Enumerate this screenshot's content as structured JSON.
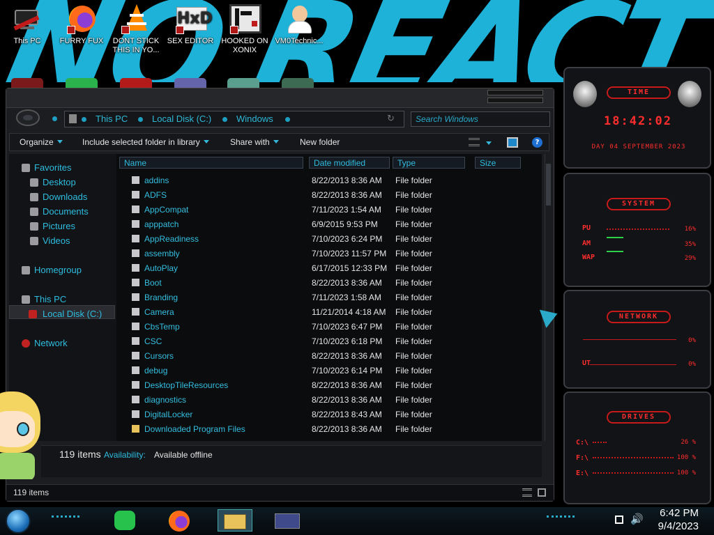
{
  "desktop": {
    "wallpaper_text": "NO REACT",
    "icons": [
      {
        "label": "This PC",
        "icon": "computer-icon"
      },
      {
        "label": "FURRY FUX",
        "icon": "firefox-icon"
      },
      {
        "label": "DONT STICK THIS IN YO...",
        "icon": "vlc-icon"
      },
      {
        "label": "SEX EDITOR",
        "icon": "hxd-icon"
      },
      {
        "label": "HOOKED ON XONIX",
        "icon": "xonix-icon"
      },
      {
        "label": "VM0Technic...",
        "icon": "user-icon"
      }
    ]
  },
  "explorer": {
    "breadcrumb": [
      "This PC",
      "Local Disk (C:)",
      "Windows"
    ],
    "search_placeholder": "Search Windows",
    "toolbar": {
      "organize": "Organize",
      "include": "Include selected folder in library",
      "share": "Share with",
      "new_folder": "New folder"
    },
    "nav": {
      "favorites": "Favorites",
      "desktop": "Desktop",
      "downloads": "Downloads",
      "documents": "Documents",
      "pictures": "Pictures",
      "videos": "Videos",
      "homegroup": "Homegroup",
      "this_pc": "This PC",
      "local_disk": "Local Disk (C:)",
      "network": "Network"
    },
    "columns": {
      "name": "Name",
      "date": "Date modified",
      "type": "Type",
      "size": "Size"
    },
    "rows": [
      {
        "name": "addins",
        "date": "8/22/2013 8:36 AM",
        "type": "File folder"
      },
      {
        "name": "ADFS",
        "date": "8/22/2013 8:36 AM",
        "type": "File folder"
      },
      {
        "name": "AppCompat",
        "date": "7/11/2023 1:54 AM",
        "type": "File folder"
      },
      {
        "name": "apppatch",
        "date": "6/9/2015 9:53 PM",
        "type": "File folder"
      },
      {
        "name": "AppReadiness",
        "date": "7/10/2023 6:24 PM",
        "type": "File folder"
      },
      {
        "name": "assembly",
        "date": "7/10/2023 11:57 PM",
        "type": "File folder"
      },
      {
        "name": "AutoPlay",
        "date": "6/17/2015 12:33 PM",
        "type": "File folder"
      },
      {
        "name": "Boot",
        "date": "8/22/2013 8:36 AM",
        "type": "File folder"
      },
      {
        "name": "Branding",
        "date": "7/11/2023 1:58 AM",
        "type": "File folder"
      },
      {
        "name": "Camera",
        "date": "11/21/2014 4:18 AM",
        "type": "File folder"
      },
      {
        "name": "CbsTemp",
        "date": "7/10/2023 6:47 PM",
        "type": "File folder"
      },
      {
        "name": "CSC",
        "date": "7/10/2023 6:18 PM",
        "type": "File folder"
      },
      {
        "name": "Cursors",
        "date": "8/22/2013 8:36 AM",
        "type": "File folder"
      },
      {
        "name": "debug",
        "date": "7/10/2023 6:14 PM",
        "type": "File folder"
      },
      {
        "name": "DesktopTileResources",
        "date": "8/22/2013 8:36 AM",
        "type": "File folder"
      },
      {
        "name": "diagnostics",
        "date": "8/22/2013 8:36 AM",
        "type": "File folder"
      },
      {
        "name": "DigitalLocker",
        "date": "8/22/2013 8:43 AM",
        "type": "File folder"
      },
      {
        "name": "Downloaded Program Files",
        "date": "8/22/2013 8:36 AM",
        "type": "File folder"
      }
    ],
    "details": {
      "count": "119 items",
      "availability_label": "Availability:",
      "availability_value": "Available offline"
    },
    "status_count": "119 items"
  },
  "gadgets": {
    "time": {
      "title": "TIME",
      "clock": "18:42:02",
      "date": "DAY 04 SEPTEMBER 2023"
    },
    "system": {
      "title": "SYSTEM",
      "cpu_label": "PU",
      "cpu_value": "16%",
      "ram_label": "AM",
      "ram_value": "35%",
      "swap_label": "WAP",
      "swap_value": "29%"
    },
    "network": {
      "title": "NETWORK",
      "in_value": "0%",
      "out_label": "UT",
      "out_value": "0%"
    },
    "drives": {
      "title": "DRIVES",
      "items": [
        {
          "label": "C:\\",
          "value": "26 %"
        },
        {
          "label": "F:\\",
          "value": "100 %"
        },
        {
          "label": "E:\\",
          "value": "100 %"
        }
      ]
    }
  },
  "taskbar": {
    "time": "6:42 PM",
    "date": "9/4/2023"
  },
  "colors": {
    "accent": "#2fbde0",
    "gadget_red": "#ff2d2d"
  }
}
